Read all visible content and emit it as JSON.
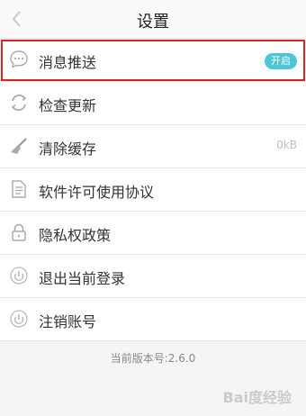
{
  "header": {
    "title": "设置"
  },
  "items": [
    {
      "label": "消息推送",
      "badge": "开启",
      "icon": "message-icon"
    },
    {
      "label": "检查更新",
      "icon": "refresh-icon"
    },
    {
      "label": "清除缓存",
      "value": "0kB",
      "icon": "broom-icon"
    },
    {
      "label": "软件许可使用协议",
      "icon": "document-icon"
    },
    {
      "label": "隐私权政策",
      "icon": "lock-icon"
    },
    {
      "label": "退出当前登录",
      "icon": "logout-icon"
    },
    {
      "label": "注销账号",
      "icon": "power-icon"
    }
  ],
  "footer": {
    "version": "当前版本号:2.6.0"
  },
  "watermark": "Bai度经验",
  "colors": {
    "accent": "#4cc6d6",
    "highlight": "#e02020"
  }
}
